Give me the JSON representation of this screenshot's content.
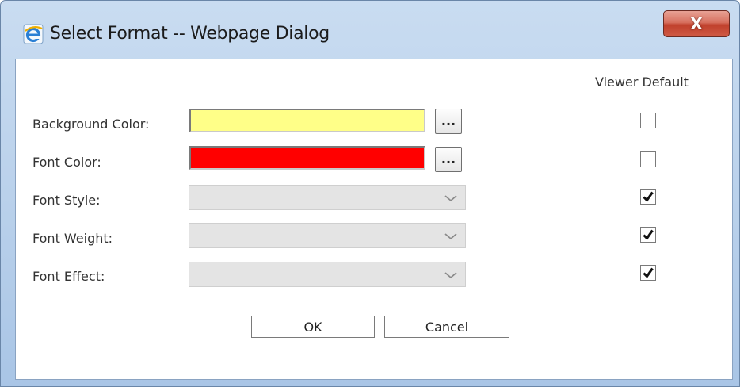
{
  "window": {
    "title": "Select Format -- Webpage Dialog",
    "close_label": "X"
  },
  "columns": {
    "viewer_default": "Viewer Default"
  },
  "rows": [
    {
      "label": "Background Color:",
      "type": "color",
      "value_color": "#ffff88",
      "viewer_default": false
    },
    {
      "label": "Font Color:",
      "type": "color",
      "value_color": "#ff0000",
      "viewer_default": false
    },
    {
      "label": "Font Style:",
      "type": "select",
      "value": "",
      "viewer_default": true
    },
    {
      "label": "Font Weight:",
      "type": "select",
      "value": "",
      "viewer_default": true
    },
    {
      "label": "Font Effect:",
      "type": "select",
      "value": "",
      "viewer_default": true
    }
  ],
  "picker_button_label": "...",
  "buttons": {
    "ok": "OK",
    "cancel": "Cancel"
  },
  "icons": {
    "title_icon": "internet-explorer-icon",
    "select_arrow": "chevron-down-icon",
    "check": "checkmark-icon"
  }
}
